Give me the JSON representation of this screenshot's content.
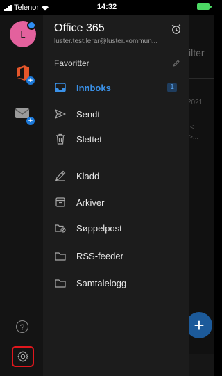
{
  "status_bar": {
    "carrier": "Telenor",
    "time": "14:32"
  },
  "rail": {
    "avatar_initial": "L",
    "help_label": "?"
  },
  "drawer": {
    "account_name": "Office 365",
    "account_email": "luster.test.lerar@luster.kommun...",
    "section_title": "Favoritter",
    "folders": [
      {
        "label": "Innboks",
        "icon": "inbox-icon",
        "active": true,
        "count": "1"
      },
      {
        "label": "Sendt",
        "icon": "send-icon"
      },
      {
        "label": "Slettet",
        "icon": "trash-icon"
      },
      {
        "label": "Kladd",
        "icon": "draft-icon"
      },
      {
        "label": "Arkiver",
        "icon": "archive-icon"
      },
      {
        "label": "Søppelpost",
        "icon": "junk-icon"
      },
      {
        "label": "RSS-feeder",
        "icon": "folder-icon"
      },
      {
        "label": "Samtalelogg",
        "icon": "folder-icon"
      }
    ]
  },
  "background": {
    "filter_text": "ilter",
    "year_text": "2021",
    "fab_label": "+"
  },
  "colors": {
    "accent": "#3a91e8",
    "avatar": "#e3619d",
    "highlight_border": "#e0171d"
  }
}
